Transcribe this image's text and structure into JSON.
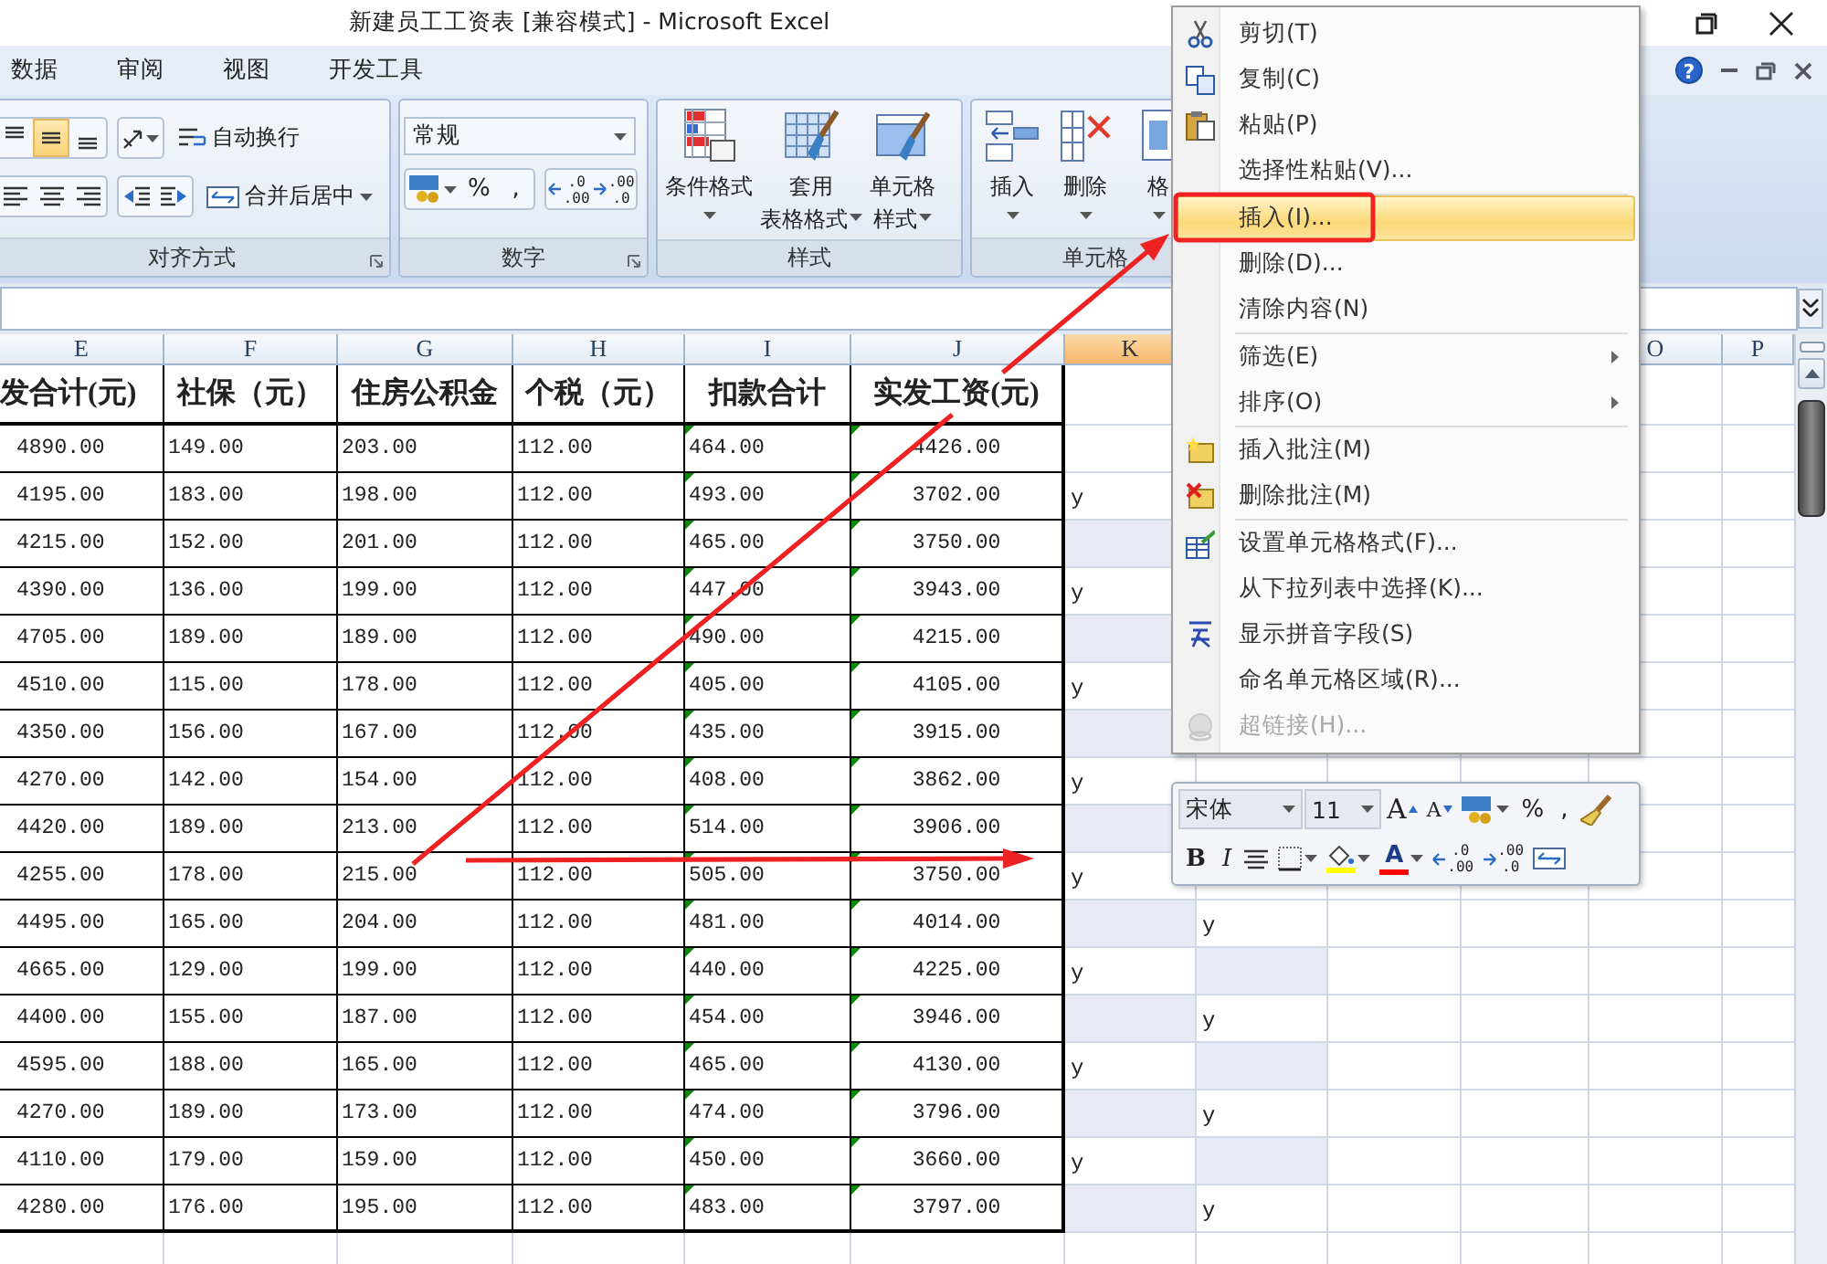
{
  "window": {
    "title": "新建员工工资表  [兼容模式] - Microsoft Excel",
    "help": "?"
  },
  "ribbon_tabs": [
    {
      "label": "数据",
      "selected": false
    },
    {
      "label": "审阅",
      "selected": false
    },
    {
      "label": "视图",
      "selected": false
    },
    {
      "label": "开发工具",
      "selected": false
    }
  ],
  "ribbon_groups": [
    {
      "label": "对齐方式",
      "launcher": true,
      "rows": [
        [
          [
            {
              "kind": "align-top",
              "selected": false
            },
            {
              "kind": "align-middle",
              "selected": true
            },
            {
              "kind": "align-bottom",
              "selected": false
            }
          ],
          [
            {
              "kind": "orientation",
              "dropdown": true
            }
          ],
          [
            {
              "kind": "wrap",
              "label": "自动换行"
            }
          ]
        ],
        [
          [
            {
              "kind": "align-left",
              "selected": false
            },
            {
              "kind": "align-center",
              "selected": false
            },
            {
              "kind": "align-right",
              "selected": false
            }
          ],
          [
            {
              "kind": "indent-dec"
            },
            {
              "kind": "indent-inc"
            }
          ],
          [
            {
              "kind": "merge",
              "label": "合并后居中",
              "dropdown": true
            }
          ]
        ]
      ]
    },
    {
      "label": "数字",
      "launcher": true,
      "format": "常规",
      "rows": [
        [
          [
            {
              "kind": "accounting",
              "dropdown": true
            },
            {
              "kind": "text",
              "label": "%"
            },
            {
              "kind": "text",
              "label": ","
            }
          ],
          [
            {
              "kind": "inc-decimal",
              "labels": [
                ".0",
                ".00"
              ]
            },
            {
              "kind": "dec-decimal",
              "labels": [
                ".00",
                ".0"
              ]
            }
          ]
        ]
      ]
    },
    {
      "label": "样式",
      "big": [
        {
          "kind": "cond-format",
          "lines": [
            "条件格式"
          ],
          "dropdown": true
        },
        {
          "kind": "table-format",
          "lines": [
            "套用",
            "表格格式"
          ],
          "dropdown": true
        },
        {
          "kind": "cell-style",
          "lines": [
            "单元格",
            "样式"
          ],
          "dropdown": true
        }
      ]
    },
    {
      "label": "单元格",
      "big": [
        {
          "kind": "insert-cells",
          "lines": [
            "插入"
          ],
          "dropdown": true
        },
        {
          "kind": "delete-cells",
          "lines": [
            "删除"
          ],
          "dropdown": true
        },
        {
          "kind": "format-cells",
          "lines": [
            "格"
          ],
          "dropdown": true
        }
      ]
    }
  ],
  "sheet": {
    "columns": [
      {
        "label": "E",
        "selected": false
      },
      {
        "label": "F",
        "selected": false
      },
      {
        "label": "G",
        "selected": false
      },
      {
        "label": "H",
        "selected": false
      },
      {
        "label": "I",
        "selected": false
      },
      {
        "label": "J",
        "selected": false
      },
      {
        "label": "K",
        "selected": true
      },
      {
        "label": "O",
        "selected": false
      },
      {
        "label": "P",
        "selected": false
      }
    ],
    "headers": [
      "发合计(元)",
      "社保（元）",
      "住房公积金",
      "个税（元）",
      "扣款合计",
      "实发工资(元)"
    ],
    "rows": [
      {
        "values": [
          "4890.00",
          "149.00",
          "203.00",
          "112.00",
          "464.00",
          "4426.00"
        ],
        "warning": true
      },
      {
        "values": [
          "4195.00",
          "183.00",
          "198.00",
          "112.00",
          "493.00",
          "3702.00"
        ],
        "warning": true,
        "k": {
          "text": "y",
          "shaded": false
        }
      },
      {
        "values": [
          "4215.00",
          "152.00",
          "201.00",
          "112.00",
          "465.00",
          "3750.00"
        ],
        "warning": true,
        "k": {
          "shaded": true
        }
      },
      {
        "values": [
          "4390.00",
          "136.00",
          "199.00",
          "112.00",
          "447.00",
          "3943.00"
        ],
        "warning": true,
        "k": {
          "text": "y",
          "shaded": false
        }
      },
      {
        "values": [
          "4705.00",
          "189.00",
          "189.00",
          "112.00",
          "490.00",
          "4215.00"
        ],
        "warning": true,
        "k": {
          "shaded": true
        }
      },
      {
        "values": [
          "4510.00",
          "115.00",
          "178.00",
          "112.00",
          "405.00",
          "4105.00"
        ],
        "warning": true,
        "k": {
          "text": "y",
          "shaded": false
        }
      },
      {
        "values": [
          "4350.00",
          "156.00",
          "167.00",
          "112.00",
          "435.00",
          "3915.00"
        ],
        "warning": true,
        "k": {
          "shaded": true
        }
      },
      {
        "values": [
          "4270.00",
          "142.00",
          "154.00",
          "112.00",
          "408.00",
          "3862.00"
        ],
        "warning": true,
        "k": {
          "text": "y",
          "shaded": false
        }
      },
      {
        "values": [
          "4420.00",
          "189.00",
          "213.00",
          "112.00",
          "514.00",
          "3906.00"
        ],
        "warning": true,
        "k": {
          "shaded": true
        }
      },
      {
        "values": [
          "4255.00",
          "178.00",
          "215.00",
          "112.00",
          "505.00",
          "3750.00"
        ],
        "warning": true,
        "k": {
          "text": "y",
          "shaded": false
        }
      },
      {
        "values": [
          "4495.00",
          "165.00",
          "204.00",
          "112.00",
          "481.00",
          "4014.00"
        ],
        "warning": true,
        "k": {
          "shaded": true
        },
        "l": {
          "text": "y",
          "shaded": false
        }
      },
      {
        "values": [
          "4665.00",
          "129.00",
          "199.00",
          "112.00",
          "440.00",
          "4225.00"
        ],
        "warning": true,
        "k": {
          "text": "y",
          "shaded": false
        },
        "l": {
          "shaded": true
        }
      },
      {
        "values": [
          "4400.00",
          "155.00",
          "187.00",
          "112.00",
          "454.00",
          "3946.00"
        ],
        "warning": true,
        "k": {
          "shaded": true
        },
        "l": {
          "text": "y",
          "shaded": false
        }
      },
      {
        "values": [
          "4595.00",
          "188.00",
          "165.00",
          "112.00",
          "465.00",
          "4130.00"
        ],
        "warning": true,
        "k": {
          "text": "y",
          "shaded": false
        },
        "l": {
          "shaded": true
        }
      },
      {
        "values": [
          "4270.00",
          "189.00",
          "173.00",
          "112.00",
          "474.00",
          "3796.00"
        ],
        "warning": true,
        "k": {
          "shaded": true
        },
        "l": {
          "text": "y",
          "shaded": false
        }
      },
      {
        "values": [
          "4110.00",
          "179.00",
          "159.00",
          "112.00",
          "450.00",
          "3660.00"
        ],
        "warning": true,
        "k": {
          "text": "y",
          "shaded": false
        },
        "l": {
          "shaded": true
        }
      },
      {
        "values": [
          "4280.00",
          "176.00",
          "195.00",
          "112.00",
          "483.00",
          "3797.00"
        ],
        "warning": true,
        "k": {
          "shaded": true
        },
        "l": {
          "text": "y",
          "shaded": false
        }
      }
    ]
  },
  "context_menu": {
    "sections": [
      [
        {
          "label": "剪切(T)",
          "selected": false,
          "disabled": false,
          "submenu": false
        },
        {
          "label": "复制(C)",
          "selected": false,
          "disabled": false,
          "submenu": false
        },
        {
          "label": "粘贴(P)",
          "selected": false,
          "disabled": false,
          "submenu": false
        },
        {
          "label": "选择性粘贴(V)...",
          "selected": false,
          "disabled": false,
          "submenu": false
        }
      ],
      [
        {
          "label": "插入(I)...",
          "selected": true,
          "disabled": false,
          "submenu": false
        },
        {
          "label": "删除(D)...",
          "selected": false,
          "disabled": false,
          "submenu": false
        },
        {
          "label": "清除内容(N)",
          "selected": false,
          "disabled": false,
          "submenu": false
        }
      ],
      [
        {
          "label": "筛选(E)",
          "selected": false,
          "disabled": false,
          "submenu": true
        },
        {
          "label": "排序(O)",
          "selected": false,
          "disabled": false,
          "submenu": true
        }
      ],
      [
        {
          "label": "插入批注(M)",
          "selected": false,
          "disabled": false,
          "submenu": false
        },
        {
          "label": "删除批注(M)",
          "selected": false,
          "disabled": false,
          "submenu": false
        }
      ],
      [
        {
          "label": "设置单元格格式(F)...",
          "selected": false,
          "disabled": false,
          "submenu": false
        },
        {
          "label": "从下拉列表中选择(K)...",
          "selected": false,
          "disabled": false,
          "submenu": false
        },
        {
          "label": "显示拼音字段(S)",
          "selected": false,
          "disabled": false,
          "submenu": false
        },
        {
          "label": "命名单元格区域(R)...",
          "selected": false,
          "disabled": false,
          "submenu": false
        },
        {
          "label": "超链接(H)...",
          "selected": false,
          "disabled": true,
          "submenu": false
        }
      ]
    ]
  },
  "mini_toolbar": {
    "font": "宋体",
    "size": "11",
    "top_buttons": [
      {
        "kind": "grow-font",
        "label": "A"
      },
      {
        "kind": "shrink-font",
        "label": "A"
      },
      {
        "kind": "accounting",
        "dropdown": true
      },
      {
        "kind": "text",
        "label": "%"
      },
      {
        "kind": "text",
        "label": ","
      },
      {
        "kind": "brush"
      }
    ],
    "bottom_buttons": [
      {
        "kind": "bold",
        "label": "B"
      },
      {
        "kind": "italic",
        "label": "I"
      },
      {
        "kind": "center"
      },
      {
        "kind": "border",
        "dropdown": true
      },
      {
        "kind": "fill",
        "dropdown": true,
        "color": "#ffff00"
      },
      {
        "kind": "font-color",
        "label": "A",
        "dropdown": true,
        "color": "#ff0000"
      },
      {
        "kind": "inc-decimal",
        "labels": [
          ".0",
          ".00"
        ]
      },
      {
        "kind": "dec-decimal",
        "labels": [
          ".00",
          ".0"
        ]
      },
      {
        "kind": "merge"
      }
    ]
  },
  "annotations": [
    {
      "kind": "arrow"
    },
    {
      "kind": "arrow"
    },
    {
      "kind": "frame"
    }
  ]
}
